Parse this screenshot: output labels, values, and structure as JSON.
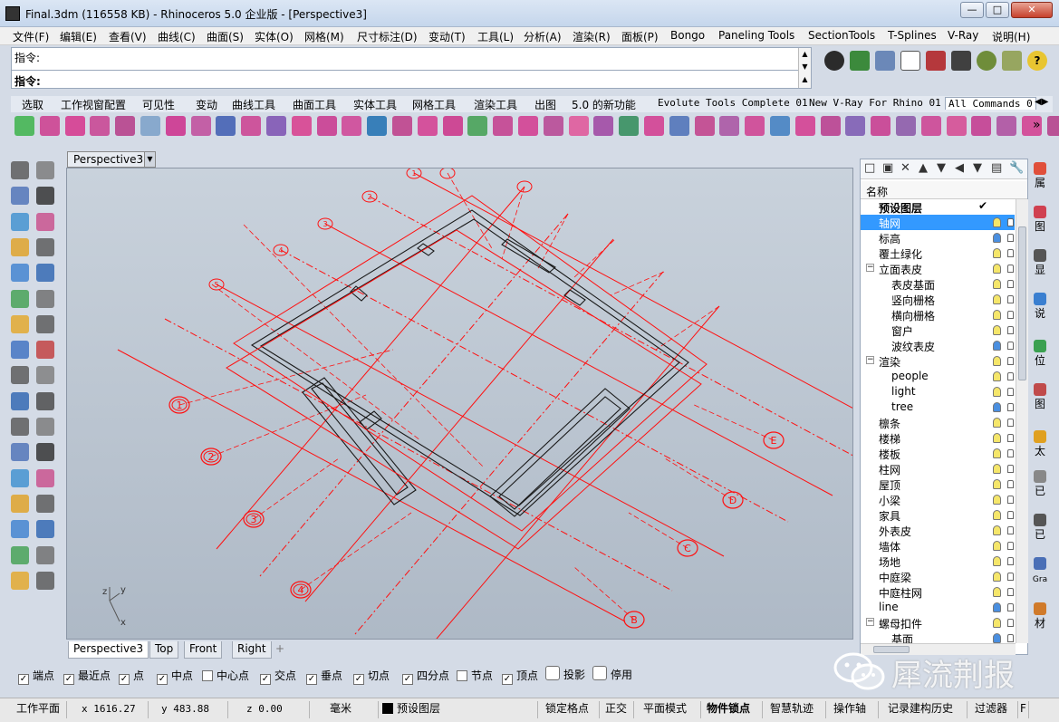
{
  "window": {
    "title": "Final.3dm (116558 KB) - Rhinoceros  5.0 企业版 - [Perspective3]",
    "minimize": "—",
    "maximize": "□",
    "close": "✕"
  },
  "menu": [
    "文件(F)",
    "编辑(E)",
    "查看(V)",
    "曲线(C)",
    "曲面(S)",
    "实体(O)",
    "网格(M)",
    "尺寸标注(D)",
    "变动(T)",
    "工具(L)",
    "分析(A)",
    "渲染(R)",
    "面板(P)",
    "Bongo",
    "Paneling Tools",
    "SectionTools",
    "T-Splines",
    "V-Ray",
    "说明(H)"
  ],
  "command": {
    "history_line": "指令:",
    "prompt": "指令:"
  },
  "toolbar_tabs": [
    "选取",
    "工作视窗配置",
    "可见性",
    "变动",
    "曲线工具",
    "曲面工具",
    "实体工具",
    "网格工具",
    "渲染工具",
    "出图",
    "5.0 的新功能",
    "Evolute Tools Complete 01",
    "New V-Ray For Rhino 01",
    "All Commands 0"
  ],
  "toolbar_tab_active": "All Commands 0",
  "viewport": {
    "active_name": "Perspective3",
    "axis_labels": {
      "z": "z",
      "y": "y",
      "x": "x"
    },
    "grid_labels_numeric": [
      "1",
      "2",
      "3",
      "4",
      "5",
      "6",
      "7",
      "8",
      "9",
      "10",
      "11"
    ],
    "grid_labels_alpha": [
      "E",
      "D",
      "C",
      "B"
    ]
  },
  "viewport_tabs": [
    "Perspective3",
    "Top",
    "Front",
    "Right"
  ],
  "viewport_tab_add": "+",
  "snaps": [
    {
      "label": "端点",
      "checked": true
    },
    {
      "label": "最近点",
      "checked": true
    },
    {
      "label": "点",
      "checked": true
    },
    {
      "label": "中点",
      "checked": true
    },
    {
      "label": "中心点",
      "checked": false
    },
    {
      "label": "交点",
      "checked": true
    },
    {
      "label": "垂点",
      "checked": true
    },
    {
      "label": "切点",
      "checked": true
    },
    {
      "label": "四分点",
      "checked": true
    },
    {
      "label": "节点",
      "checked": false
    },
    {
      "label": "顶点",
      "checked": true
    }
  ],
  "snap_toggles": [
    {
      "label": "投影",
      "checked": false
    },
    {
      "label": "停用",
      "checked": false
    }
  ],
  "status": {
    "cplane": "工作平面",
    "x": "x 1616.27",
    "y": "y 483.88",
    "z": "z 0.00",
    "units": "毫米",
    "layer": "预设图层",
    "grid_snap": "锁定格点",
    "ortho": "正交",
    "planar": "平面模式",
    "osnap": "物件锁点",
    "smarttrack": "智慧轨迹",
    "gumball": "操作轴",
    "history": "记录建构历史",
    "filter": "过滤器",
    "extra": "F"
  },
  "layers": {
    "header": "名称",
    "rows": [
      {
        "name": "预设图层",
        "indent": 1,
        "bold": true,
        "current": true,
        "bulb": "none",
        "lock": false
      },
      {
        "name": "轴网",
        "indent": 1,
        "selected": true,
        "bulb": "#f5e66a",
        "lock": true
      },
      {
        "name": "标高",
        "indent": 1,
        "bulb": "#4a8fe0",
        "lock": true
      },
      {
        "name": "覆土绿化",
        "indent": 1,
        "bulb": "#f5e66a",
        "lock": true
      },
      {
        "name": "立面表皮",
        "indent": 1,
        "expand": "−",
        "bulb": "#f5e66a",
        "lock": true
      },
      {
        "name": "表皮基面",
        "indent": 2,
        "bulb": "#f5e66a",
        "lock": true
      },
      {
        "name": "竖向栅格",
        "indent": 2,
        "bulb": "#f5e66a",
        "lock": true
      },
      {
        "name": "横向栅格",
        "indent": 2,
        "bulb": "#f5e66a",
        "lock": true
      },
      {
        "name": "窗户",
        "indent": 2,
        "bulb": "#f5e66a",
        "lock": true
      },
      {
        "name": "波纹表皮",
        "indent": 2,
        "bulb": "#4a8fe0",
        "lock": true
      },
      {
        "name": "渲染",
        "indent": 1,
        "expand": "−",
        "bulb": "#f5e66a",
        "lock": true
      },
      {
        "name": "people",
        "indent": 2,
        "bulb": "#f5e66a",
        "lock": true
      },
      {
        "name": "light",
        "indent": 2,
        "bulb": "#f5e66a",
        "lock": true
      },
      {
        "name": "tree",
        "indent": 2,
        "bulb": "#4a8fe0",
        "lock": true
      },
      {
        "name": "檩条",
        "indent": 1,
        "bulb": "#f5e66a",
        "lock": true
      },
      {
        "name": "楼梯",
        "indent": 1,
        "bulb": "#f5e66a",
        "lock": true
      },
      {
        "name": "楼板",
        "indent": 1,
        "bulb": "#f5e66a",
        "lock": true
      },
      {
        "name": "柱网",
        "indent": 1,
        "bulb": "#f5e66a",
        "lock": true
      },
      {
        "name": "屋顶",
        "indent": 1,
        "bulb": "#f5e66a",
        "lock": true
      },
      {
        "name": "小梁",
        "indent": 1,
        "bulb": "#f5e66a",
        "lock": true
      },
      {
        "name": "家具",
        "indent": 1,
        "bulb": "#f5e66a",
        "lock": true
      },
      {
        "name": "外表皮",
        "indent": 1,
        "bulb": "#f5e66a",
        "lock": true
      },
      {
        "name": "墙体",
        "indent": 1,
        "bulb": "#f5e66a",
        "lock": true
      },
      {
        "name": "场地",
        "indent": 1,
        "bulb": "#f5e66a",
        "lock": true
      },
      {
        "name": "中庭梁",
        "indent": 1,
        "bulb": "#f5e66a",
        "lock": true
      },
      {
        "name": "中庭柱网",
        "indent": 1,
        "bulb": "#f5e66a",
        "lock": true
      },
      {
        "name": "line",
        "indent": 1,
        "bulb": "#4a8fe0",
        "lock": true
      },
      {
        "name": "螺母扣件",
        "indent": 1,
        "expand": "−",
        "bulb": "#f5e66a",
        "lock": true
      },
      {
        "name": "基面",
        "indent": 2,
        "bulb": "#4a8fe0",
        "lock": true
      }
    ]
  },
  "side_tabs": [
    "属",
    "图",
    "显",
    "说",
    "位",
    "图",
    "太",
    "已",
    "已",
    "Gra",
    "材"
  ],
  "watermark": "犀流荆报",
  "colors": {
    "grid_red": "#ff1010",
    "building_black": "#1a1a1a",
    "selection_blue": "#3399ff",
    "bulb_on": "#f5e66a",
    "bulb_blue": "#4a8fe0"
  }
}
